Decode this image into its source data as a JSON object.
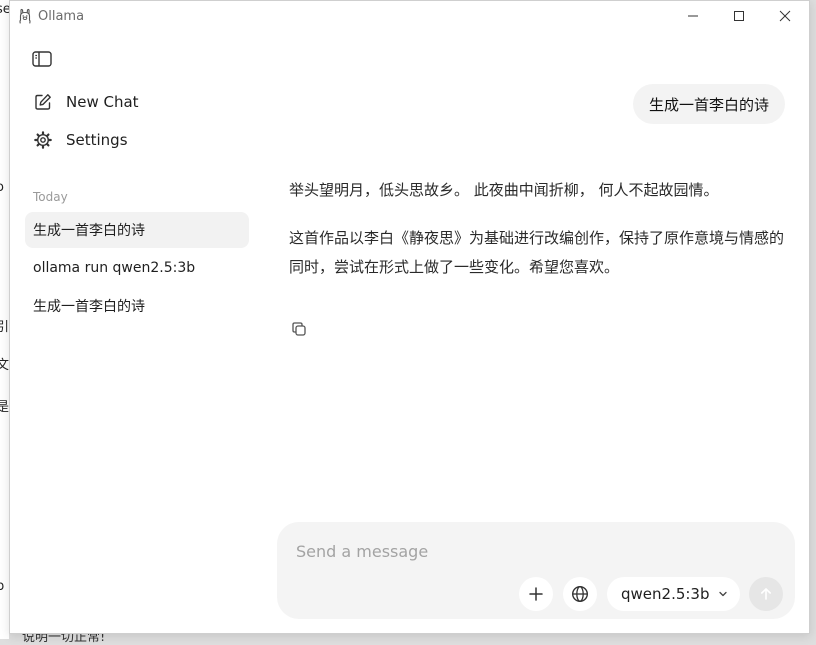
{
  "window": {
    "title": "Ollama"
  },
  "sidebar": {
    "new_chat_label": "New Chat",
    "settings_label": "Settings",
    "section_label": "Today",
    "history": [
      {
        "label": "生成一首李白的诗",
        "active": true
      },
      {
        "label": "ollama run qwen2.5:3b",
        "active": false
      },
      {
        "label": "生成一首李白的诗",
        "active": false
      }
    ]
  },
  "chat": {
    "user_message": "生成一首李白的诗",
    "assistant_paragraphs": [
      "举头望明月，低头思故乡。 此夜曲中闻折柳， 何人不起故园情。",
      "这首作品以李白《静夜思》为基础进行改编创作，保持了原作意境与情感的同时，尝试在形式上做了一些变化。希望您喜欢。"
    ]
  },
  "composer": {
    "placeholder": "Send a message",
    "model": "qwen2.5:3b"
  },
  "background": {
    "edge_chars": [
      "se",
      "o",
      ":",
      "引",
      "文",
      "是",
      "b"
    ],
    "bottom_text": "说明一切正常!"
  },
  "colors": {
    "bubble": "#f3f3f3",
    "active_item": "#f2f2f2",
    "composer": "#f4f4f4",
    "send_disabled": "#e6e6e6"
  },
  "icons": {
    "logo": "ollama-llama-icon",
    "sidebar_toggle": "sidebar-panel-icon",
    "new_chat": "edit-square-icon",
    "settings": "gear-icon",
    "copy": "copy-icon",
    "add": "plus-icon",
    "web": "globe-icon",
    "model_dropdown": "chevron-down-icon",
    "send": "arrow-up-icon"
  }
}
